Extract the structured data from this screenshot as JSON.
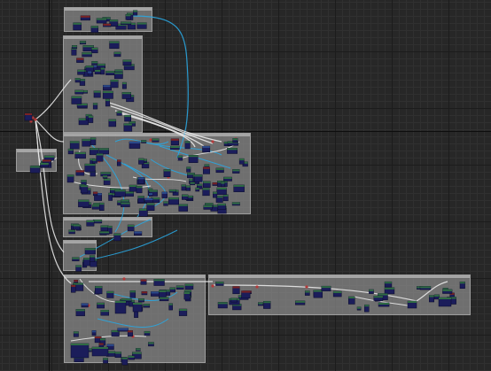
{
  "editor": {
    "kind": "node-graph-editor",
    "visible_text": []
  },
  "colors": {
    "background": "#272727",
    "grid_major": "#1c1c1c",
    "grid_minor": "#303030",
    "comment_fill": "#8c8c8c",
    "comment_border": "#9d9d9d",
    "node_body": "#1b1d5a",
    "node_header_green": "#2f6b43",
    "node_header_red": "#7a2323",
    "node_header_blue": "#2b4a8a",
    "wire_blue": "#2aa6e0",
    "wire_white": "#e8e8e8",
    "reroute_red": "#b33a3a"
  },
  "icons": {
    "reroute_node": "reroute-icon",
    "graph_node": "node-icon"
  }
}
